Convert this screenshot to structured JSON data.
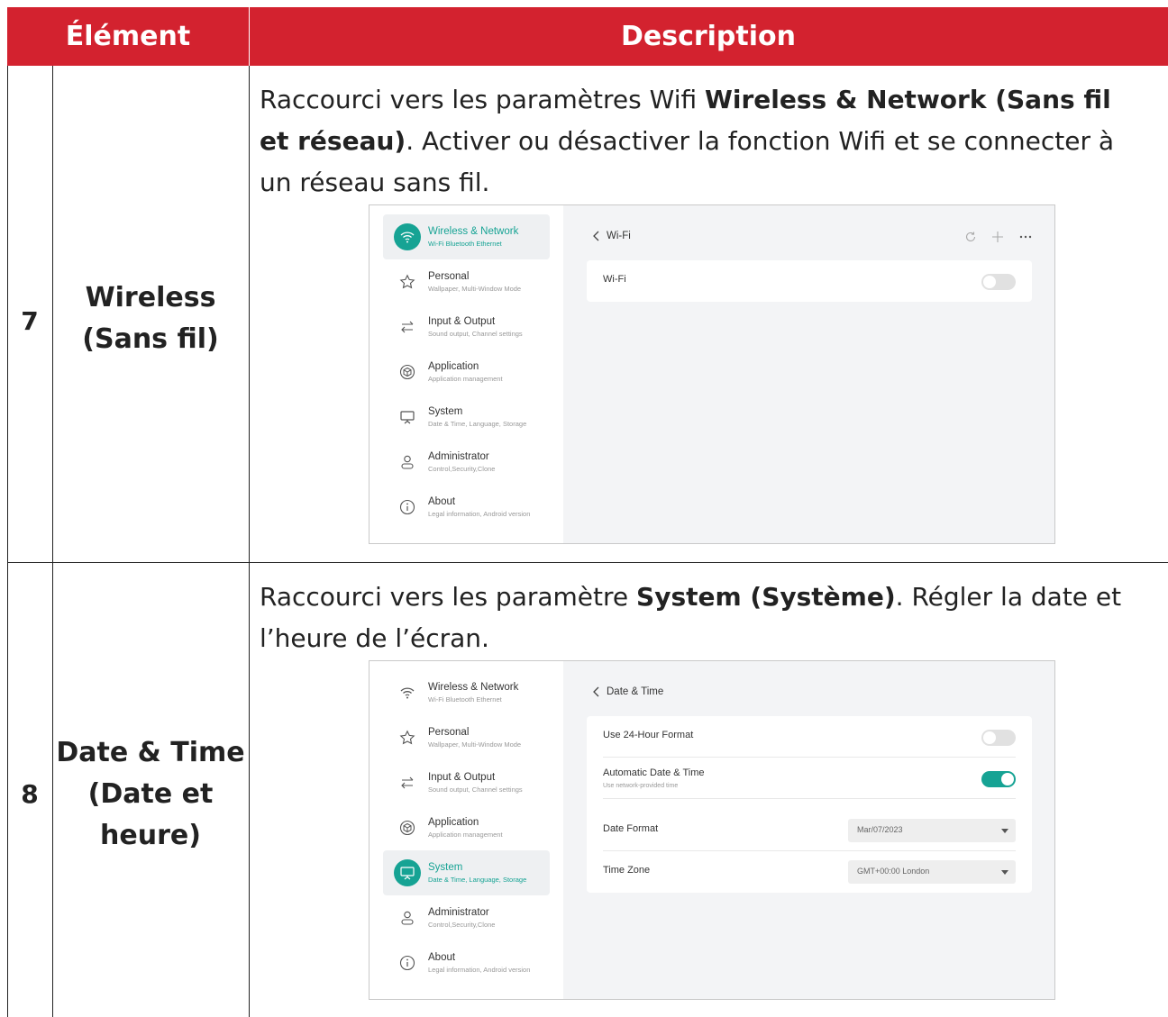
{
  "header": {
    "element": "Élément",
    "description": "Description"
  },
  "rows": [
    {
      "number": "7",
      "element_line1": "Wireless",
      "element_line2": "(Sans fil)",
      "desc_pre": "Raccourci vers les paramètres Wifi ",
      "desc_bold": "Wireless & Network (Sans fil et réseau)",
      "desc_post": ". Activer ou désactiver la fonction Wifi et se connecter à un réseau sans fil."
    },
    {
      "number": "8",
      "element_line1": "Date & Time",
      "element_line2": "(Date et",
      "element_line3": "heure)",
      "desc_pre": "Raccourci vers les paramètre ",
      "desc_bold": "System (Système)",
      "desc_post": ". Régler la date et l’heure de l’écran."
    }
  ],
  "menu": [
    {
      "title": "Wireless & Network",
      "sub": "Wi-Fi Bluetooth Ethernet",
      "icon": "wifi-icon"
    },
    {
      "title": "Personal",
      "sub": "Wallpaper, Multi-Window Mode",
      "icon": "star-icon"
    },
    {
      "title": "Input & Output",
      "sub": "Sound output, Channel settings",
      "icon": "swap-arrows-icon"
    },
    {
      "title": "Application",
      "sub": "Application management",
      "icon": "cube-icon"
    },
    {
      "title": "System",
      "sub": "Date & Time, Language, Storage",
      "icon": "display-icon"
    },
    {
      "title": "Administrator",
      "sub": "Control,Security,Clone",
      "icon": "user-icon"
    },
    {
      "title": "About",
      "sub": "Legal information, Android version",
      "icon": "info-icon"
    }
  ],
  "screen1": {
    "title": "Wi-Fi",
    "wifi_label": "Wi-Fi",
    "wifi_on": false
  },
  "screen2": {
    "title": "Date & Time",
    "use24_label": "Use 24-Hour Format",
    "use24_on": false,
    "auto_label": "Automatic Date & Time",
    "auto_sub": "Use network-provided time",
    "auto_on": true,
    "date_format_label": "Date Format",
    "date_format_value": "Mar/07/2023",
    "time_zone_label": "Time Zone",
    "time_zone_value": "GMT+00:00 London"
  },
  "colors": {
    "header_red": "#d3222f",
    "accent_teal": "#16a394"
  }
}
